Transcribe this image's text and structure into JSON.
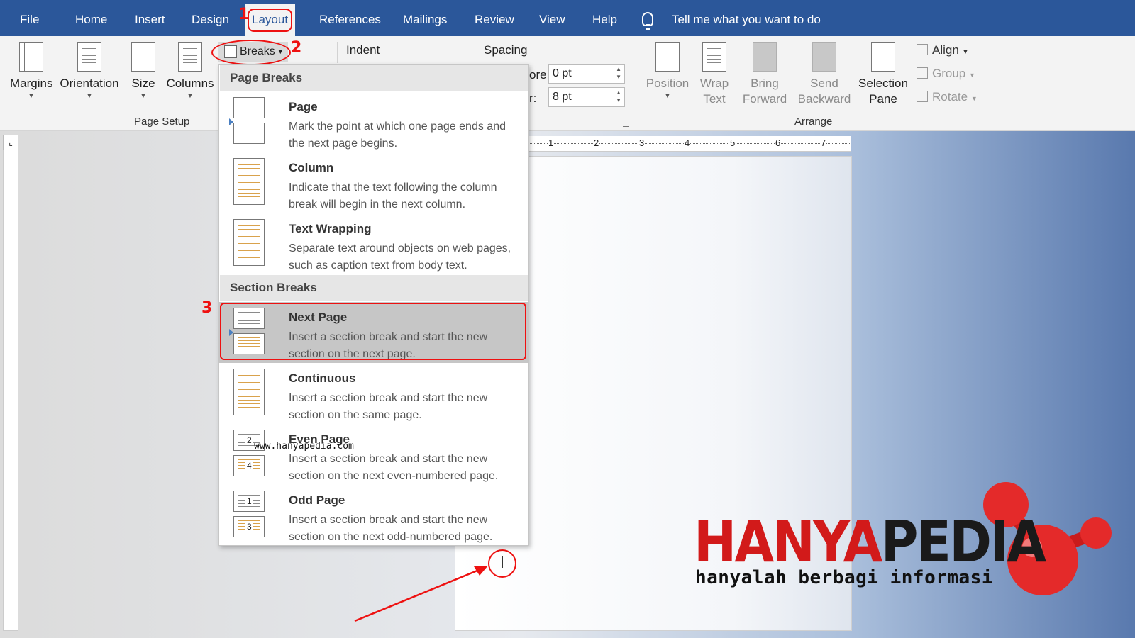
{
  "tabs": [
    "File",
    "Home",
    "Insert",
    "Design",
    "Layout",
    "References",
    "Mailings",
    "Review",
    "View",
    "Help"
  ],
  "tell_me": "Tell me what you want to do",
  "page_setup": {
    "margins": "Margins",
    "orientation": "Orientation",
    "size": "Size",
    "columns": "Columns",
    "breaks": "Breaks",
    "group_label": "Page Setup"
  },
  "paragraph": {
    "indent": "Indent",
    "spacing": "Spacing",
    "before_label": "ore:",
    "before_value": "0 pt",
    "after_label": "r:",
    "after_value": "8 pt"
  },
  "arrange": {
    "position": [
      "Position",
      ""
    ],
    "wrap": [
      "Wrap",
      "Text"
    ],
    "bring": [
      "Bring",
      "Forward"
    ],
    "send": [
      "Send",
      "Backward"
    ],
    "selection": [
      "Selection",
      "Pane"
    ],
    "align": "Align",
    "group": "Group",
    "rotate": "Rotate",
    "group_label": "Arrange"
  },
  "ruler": [
    "1",
    "2",
    "3",
    "4",
    "5",
    "6",
    "7"
  ],
  "menu": {
    "page_breaks_header": "Page Breaks",
    "section_breaks_header": "Section Breaks",
    "items": [
      {
        "title": "Page",
        "desc": "Mark the point at which one page ends and the next page begins."
      },
      {
        "title": "Column",
        "desc": "Indicate that the text following the column break will begin in the next column."
      },
      {
        "title": "Text Wrapping",
        "desc": "Separate text around objects on web pages, such as caption text from body text."
      },
      {
        "title": "Next Page",
        "desc": "Insert a section break and start the new section on the next page."
      },
      {
        "title": "Continuous",
        "desc": "Insert a section break and start the new section on the same page."
      },
      {
        "title": "Even Page",
        "desc": "Insert a section break and start the new section on the next even-numbered page."
      },
      {
        "title": "Odd Page",
        "desc": "Insert a section break and start the new section on the next odd-numbered page."
      }
    ],
    "even_icon_nums": [
      "2",
      "4"
    ],
    "odd_icon_nums": [
      "1",
      "3"
    ]
  },
  "annotations": {
    "step1": "1",
    "step2": "2",
    "step3": "3"
  },
  "watermark": "www.hanyapedia.com",
  "logo": {
    "part1": "HANYA",
    "part2": "PEDIA",
    "tagline": "hanyalah berbagi informasi"
  },
  "colors": {
    "accent": "#2b579a",
    "highlight": "#e11111"
  }
}
